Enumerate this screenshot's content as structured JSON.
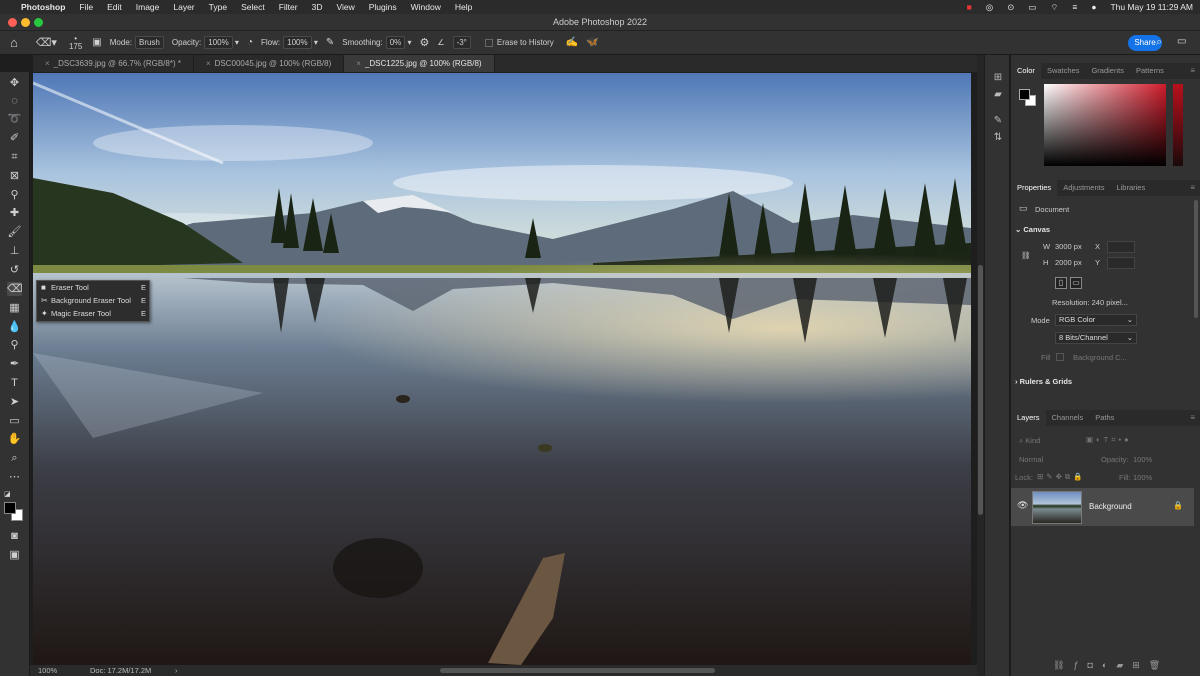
{
  "menubar": {
    "apple": "",
    "app": "Photoshop",
    "items": [
      "File",
      "Edit",
      "Image",
      "Layer",
      "Type",
      "Select",
      "Filter",
      "3D",
      "View",
      "Plugins",
      "Window",
      "Help"
    ],
    "clock": "Thu May 19  11:29 AM"
  },
  "window": {
    "title": "Adobe Photoshop 2022"
  },
  "options": {
    "brush_size": "175",
    "mode_label": "Mode:",
    "mode_value": "Brush",
    "opacity_label": "Opacity:",
    "opacity_value": "100%",
    "flow_label": "Flow:",
    "flow_value": "100%",
    "smoothing_label": "Smoothing:",
    "smoothing_value": "0%",
    "angle_value": "-3°",
    "erase_history": "Erase to History",
    "share": "Share"
  },
  "tabs": [
    {
      "label": "_DSC3639.jpg @ 66.7% (RGB/8*) *",
      "active": false
    },
    {
      "label": "DSC00045.jpg @ 100% (RGB/8)",
      "active": false
    },
    {
      "label": "_DSC1225.jpg @ 100% (RGB/8)",
      "active": true
    }
  ],
  "flyout": [
    {
      "label": "Eraser Tool",
      "shortcut": "E"
    },
    {
      "label": "Background Eraser Tool",
      "shortcut": "E"
    },
    {
      "label": "Magic Eraser Tool",
      "shortcut": "E"
    }
  ],
  "status": {
    "zoom": "100%",
    "doc": "Doc: 17.2M/17.2M"
  },
  "color_panel": {
    "tabs": [
      "Color",
      "Swatches",
      "Gradients",
      "Patterns"
    ]
  },
  "properties_panel": {
    "tabs": [
      "Properties",
      "Adjustments",
      "Libraries"
    ],
    "doc_label": "Document",
    "canvas_heading": "Canvas",
    "w_label": "W",
    "w_value": "3000 px",
    "x_label": "X",
    "h_label": "H",
    "h_value": "2000 px",
    "y_label": "Y",
    "resolution": "Resolution: 240 pixel...",
    "mode_label": "Mode",
    "mode_value": "RGB Color",
    "bits_value": "8 Bits/Channel",
    "fill_label": "Fill",
    "fill_value": "Background C...",
    "rulers_heading": "Rulers & Grids"
  },
  "layers_panel": {
    "tabs": [
      "Layers",
      "Channels",
      "Paths"
    ],
    "kind_placeholder": "Kind",
    "blend": "Normal",
    "opacity_label": "Opacity:",
    "opacity_value": "100%",
    "lock_label": "Lock:",
    "fill_label": "Fill:",
    "fill_value": "100%",
    "layer_name": "Background"
  },
  "colors": {
    "accent": "#1473e6",
    "bg": "#323232"
  }
}
